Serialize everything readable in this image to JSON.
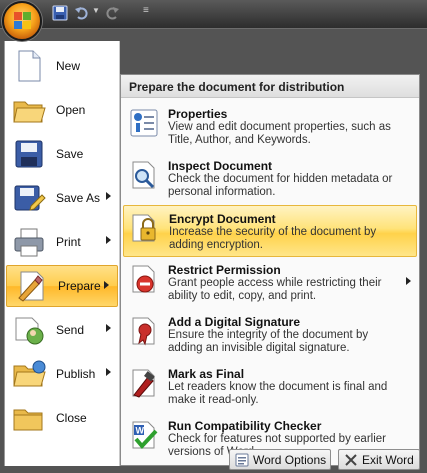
{
  "quick_access": {
    "icons": [
      "office-button-icon",
      "save-icon",
      "undo-icon",
      "redo-icon",
      "customize-qat-icon"
    ]
  },
  "left_menu": [
    {
      "label": "New",
      "icon": "new-document-icon",
      "has_submenu": false
    },
    {
      "label": "Open",
      "icon": "open-folder-icon",
      "has_submenu": false
    },
    {
      "label": "Save",
      "icon": "save-icon",
      "has_submenu": false
    },
    {
      "label": "Save As",
      "icon": "save-as-icon",
      "has_submenu": true
    },
    {
      "label": "Print",
      "icon": "printer-icon",
      "has_submenu": true
    },
    {
      "label": "Prepare",
      "icon": "prepare-icon",
      "has_submenu": true,
      "active": true
    },
    {
      "label": "Send",
      "icon": "send-icon",
      "has_submenu": true
    },
    {
      "label": "Publish",
      "icon": "publish-icon",
      "has_submenu": true
    },
    {
      "label": "Close",
      "icon": "close-folder-icon",
      "has_submenu": false
    }
  ],
  "submenu": {
    "header": "Prepare the document for distribution",
    "items": [
      {
        "title": "Properties",
        "desc": "View and edit document properties, such as Title, Author, and Keywords.",
        "icon": "properties-icon"
      },
      {
        "title": "Inspect Document",
        "desc": "Check the document for hidden metadata or personal information.",
        "icon": "inspect-document-icon"
      },
      {
        "title": "Encrypt Document",
        "desc": "Increase the security of the document by adding encryption.",
        "icon": "encrypt-lock-icon",
        "active": true
      },
      {
        "title": "Restrict Permission",
        "desc": "Grant people access while restricting their ability to edit, copy, and print.",
        "icon": "restrict-permission-icon",
        "has_submenu": true
      },
      {
        "title": "Add a Digital Signature",
        "desc": "Ensure the integrity of the document by adding an invisible digital signature.",
        "icon": "digital-signature-icon"
      },
      {
        "title": "Mark as Final",
        "desc": "Let readers know the document is final and make it read-only.",
        "icon": "mark-final-icon"
      },
      {
        "title": "Run Compatibility Checker",
        "desc": "Check for features not supported by earlier versions of Word.",
        "icon": "compatibility-checker-icon"
      }
    ]
  },
  "footer": {
    "word_options": "Word Options",
    "exit_word": "Exit Word"
  },
  "colors": {
    "highlight": "#ffd24a",
    "frame": "#545454",
    "office_orange": "#f7a21a"
  }
}
